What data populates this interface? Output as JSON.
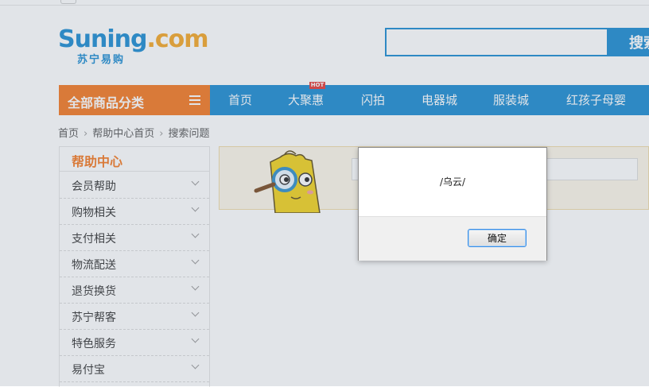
{
  "logo": {
    "word_main": "Suning",
    "word_dot": ".com",
    "sub": "苏宁易购"
  },
  "search": {
    "value": "",
    "button": "搜索"
  },
  "nav": {
    "category_label": "全部商品分类",
    "hot_badge": "HOT",
    "items": [
      "首页",
      "大聚惠",
      "闪拍",
      "电器城",
      "服装城",
      "红孩子母婴"
    ]
  },
  "breadcrumb": [
    "首页",
    "帮助中心首页",
    "搜索问题"
  ],
  "sidebar": {
    "title": "帮助中心",
    "items": [
      "会员帮助",
      "购物相关",
      "支付相关",
      "物流配送",
      "退货换货",
      "苏宁帮客",
      "特色服务",
      "易付宝"
    ]
  },
  "dialog": {
    "message": "/乌云/",
    "ok_label": "确定"
  },
  "colors": {
    "brand_blue": "#1a8bd1",
    "brand_orange": "#f5781f",
    "logo_orange": "#f5a623"
  }
}
